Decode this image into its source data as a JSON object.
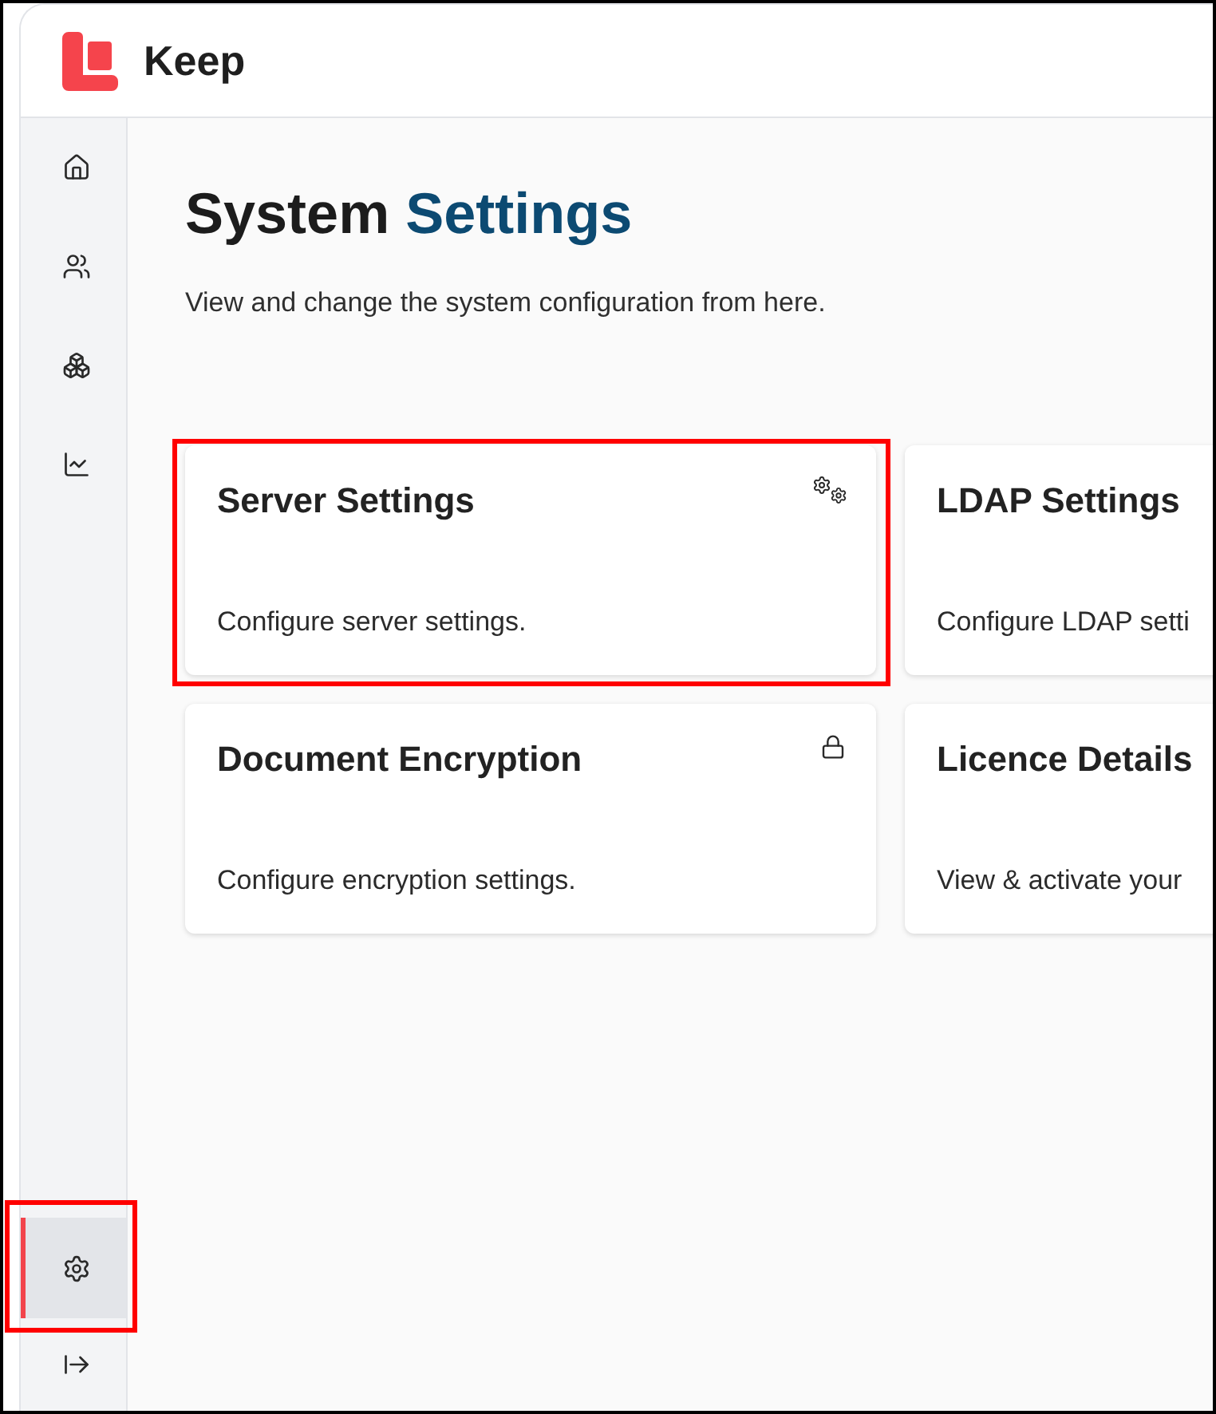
{
  "app": {
    "name": "Keep"
  },
  "sidebar": {
    "items": [
      {
        "kind": "home",
        "selected": false
      },
      {
        "kind": "people",
        "selected": false
      },
      {
        "kind": "boxes",
        "selected": false
      },
      {
        "kind": "chart",
        "selected": false
      }
    ],
    "footer_items": [
      {
        "kind": "settings",
        "selected": true,
        "highlighted": true
      },
      {
        "kind": "collapse",
        "selected": false,
        "highlighted": false
      }
    ]
  },
  "page": {
    "title": "System",
    "title_accent": "Settings",
    "subtitle": "View and change the system configuration from here."
  },
  "cards": [
    {
      "title": "Server Settings",
      "description": "Configure server settings.",
      "kind": "gears",
      "highlighted": true
    },
    {
      "title": "LDAP Settings",
      "description": "Configure LDAP setti",
      "kind": "plain",
      "highlighted": false
    },
    {
      "title": "Document Encryption",
      "description": "Configure encryption settings.",
      "kind": "lock",
      "highlighted": false
    },
    {
      "title": "Licence Details",
      "description": "View & activate your",
      "kind": "plain",
      "highlighted": false
    }
  ]
}
